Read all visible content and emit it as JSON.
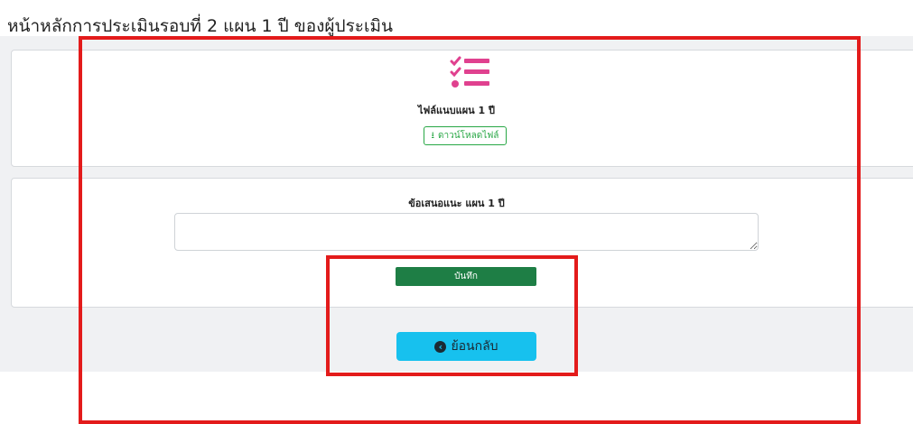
{
  "page": {
    "title": "หน้าหลักการประเมินรอบที่ 2 แผน 1 ปี ของผู้ประเมิน"
  },
  "file_section": {
    "icon": "checklist-icon",
    "label": "ไฟล์แนบแผน 1 ปี",
    "download_label": "ดาวน์โหลดไฟล์",
    "download_icon": "download-icon"
  },
  "suggestion_section": {
    "label": "ข้อเสนอแนะ แผน 1 ปี",
    "value": "",
    "placeholder": ""
  },
  "buttons": {
    "save_label": "บันทึก",
    "back_label": "ย้อนกลับ",
    "back_icon": "arrow-circle-left-icon"
  },
  "colors": {
    "accent_pink": "#e0418f",
    "save_green": "#1e7e45",
    "download_green": "#28a745",
    "back_cyan": "#17c1ee",
    "highlight_red": "#e31b1b"
  }
}
